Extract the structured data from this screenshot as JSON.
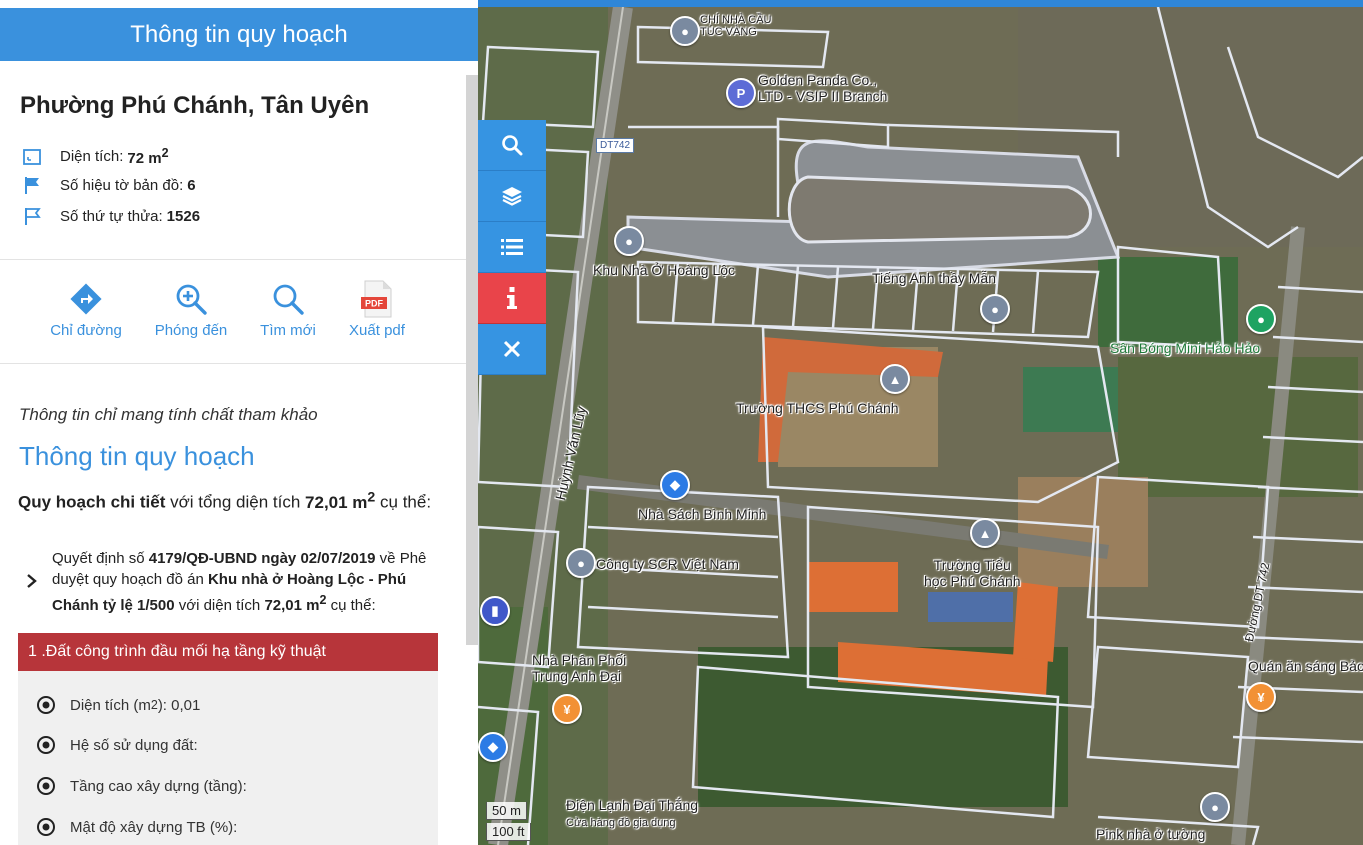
{
  "panel": {
    "header_title": "Thông tin quy hoạch",
    "place_name": "Phường Phú Chánh, Tân Uyên",
    "attributes": [
      {
        "icon": "area-icon",
        "label": "Diện tích:",
        "value": "72 m",
        "sup": "2"
      },
      {
        "icon": "flag-icon",
        "label": "Số hiệu tờ bản đồ:",
        "value": "6"
      },
      {
        "icon": "flag-outline-icon",
        "label": "Số thứ tự thửa:",
        "value": "1526"
      }
    ],
    "actions": [
      {
        "icon": "directions-icon",
        "label": "Chỉ đường"
      },
      {
        "icon": "zoom-in-icon",
        "label": "Phóng đến"
      },
      {
        "icon": "search-icon",
        "label": "Tìm mới"
      },
      {
        "icon": "pdf-icon",
        "label": "Xuất pdf",
        "icon_text": "PDF"
      }
    ],
    "note": "Thông tin chỉ mang tính chất tham khảo",
    "section_title": "Thông tin quy hoạch",
    "summary": {
      "bold_prefix": "Quy hoạch chi tiết",
      "text_1": " với tổng diện tích ",
      "bold_area": "72,01 m",
      "sup": "2",
      "text_2": " cụ thể:"
    },
    "decision": {
      "t1": "Quyết định số ",
      "b1": "4179/QĐ-UBND ngày 02/07/2019",
      "t2": " về Phê duyệt quy hoạch đồ án ",
      "b2": "Khu nhà ở Hoàng Lộc - Phú Chánh tỷ lệ 1/500",
      "t3": " với diện tích ",
      "b3": "72,01 m",
      "sup": "2",
      "t4": " cụ thể:"
    },
    "land_use": {
      "title": "1 .Đất công trình đầu mối hạ tầng kỹ thuật",
      "rows": [
        {
          "label_pre": "Diện tích (m",
          "sup": "2",
          "label_post": "): 0,01"
        },
        {
          "label_pre": "Hệ số sử dụng đất:"
        },
        {
          "label_pre": "Tầng cao xây dựng (tầng):"
        },
        {
          "label_pre": "Mật độ xây dựng TB (%):"
        }
      ]
    }
  },
  "map_tools": [
    {
      "icon": "search-icon"
    },
    {
      "icon": "layers-icon"
    },
    {
      "icon": "list-icon"
    },
    {
      "icon": "info-icon"
    },
    {
      "icon": "close-icon"
    }
  ],
  "map": {
    "labels": {
      "golden_panda_1": "Golden Panda Co.,",
      "golden_panda_2": "LTD - VSIP II Branch",
      "tuc_vang_1": "CHÍ NHÀ CẦU",
      "tuc_vang_2": "TÚC VÀNG",
      "road_badge": "DT742",
      "khu_nha_o": "Khu Nhà Ở Hoàng Lộc",
      "tieng_anh": "Tiếng Anh thầy Mẫn",
      "san_bong": "Sân Bóng Mini Hảo Hảo",
      "thcs": "Trường THCS Phú Chánh",
      "tieu_hoc_1": "Trường Tiểu",
      "tieu_hoc_2": "học Phú Chánh",
      "nha_sach": "Nhà Sách Bình Minh",
      "scr": "Công ty SCR Việt Nam",
      "nha_phan_phoi_1": "Nhà Phân Phối",
      "nha_phan_phoi_2": "Trung Anh Đại",
      "quan_an": "Quán ăn sáng Bảo",
      "dien_lanh_1": "Điện Lạnh Đại Thắng",
      "dien_lanh_2": "Cửa hàng đồ gia dụng",
      "pink_nha": "Pink nhà ở tường",
      "huynh_van_luy": "Huỳnh Văn Lũy",
      "duong_right": "Đường DT 742"
    },
    "scale_metric": "50 m",
    "scale_imperial": "100 ft"
  },
  "colors": {
    "primary": "#3a91dd",
    "danger": "#b7353a",
    "info_button": "#e9444a"
  }
}
